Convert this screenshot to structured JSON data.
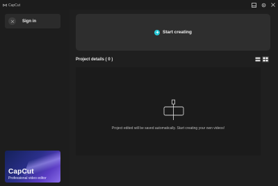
{
  "app": {
    "title": "CapCut"
  },
  "window_controls": [
    {
      "icon": "layout-icon"
    },
    {
      "icon": "gear-icon"
    },
    {
      "icon": "close-icon"
    }
  ],
  "sidebar": {
    "signin_label": "Sign in",
    "promo": {
      "brand": "CapCut",
      "tagline": "Professional video editor"
    }
  },
  "main": {
    "start_label": "Start creating",
    "projects_title": "Project details ( 0 )",
    "empty_message": "Project edited will be saved automatically. Start creating your own videos!"
  },
  "colors": {
    "accent": "#27c8d6",
    "background": "#1f1f1f",
    "card": "#2e2e2e"
  }
}
